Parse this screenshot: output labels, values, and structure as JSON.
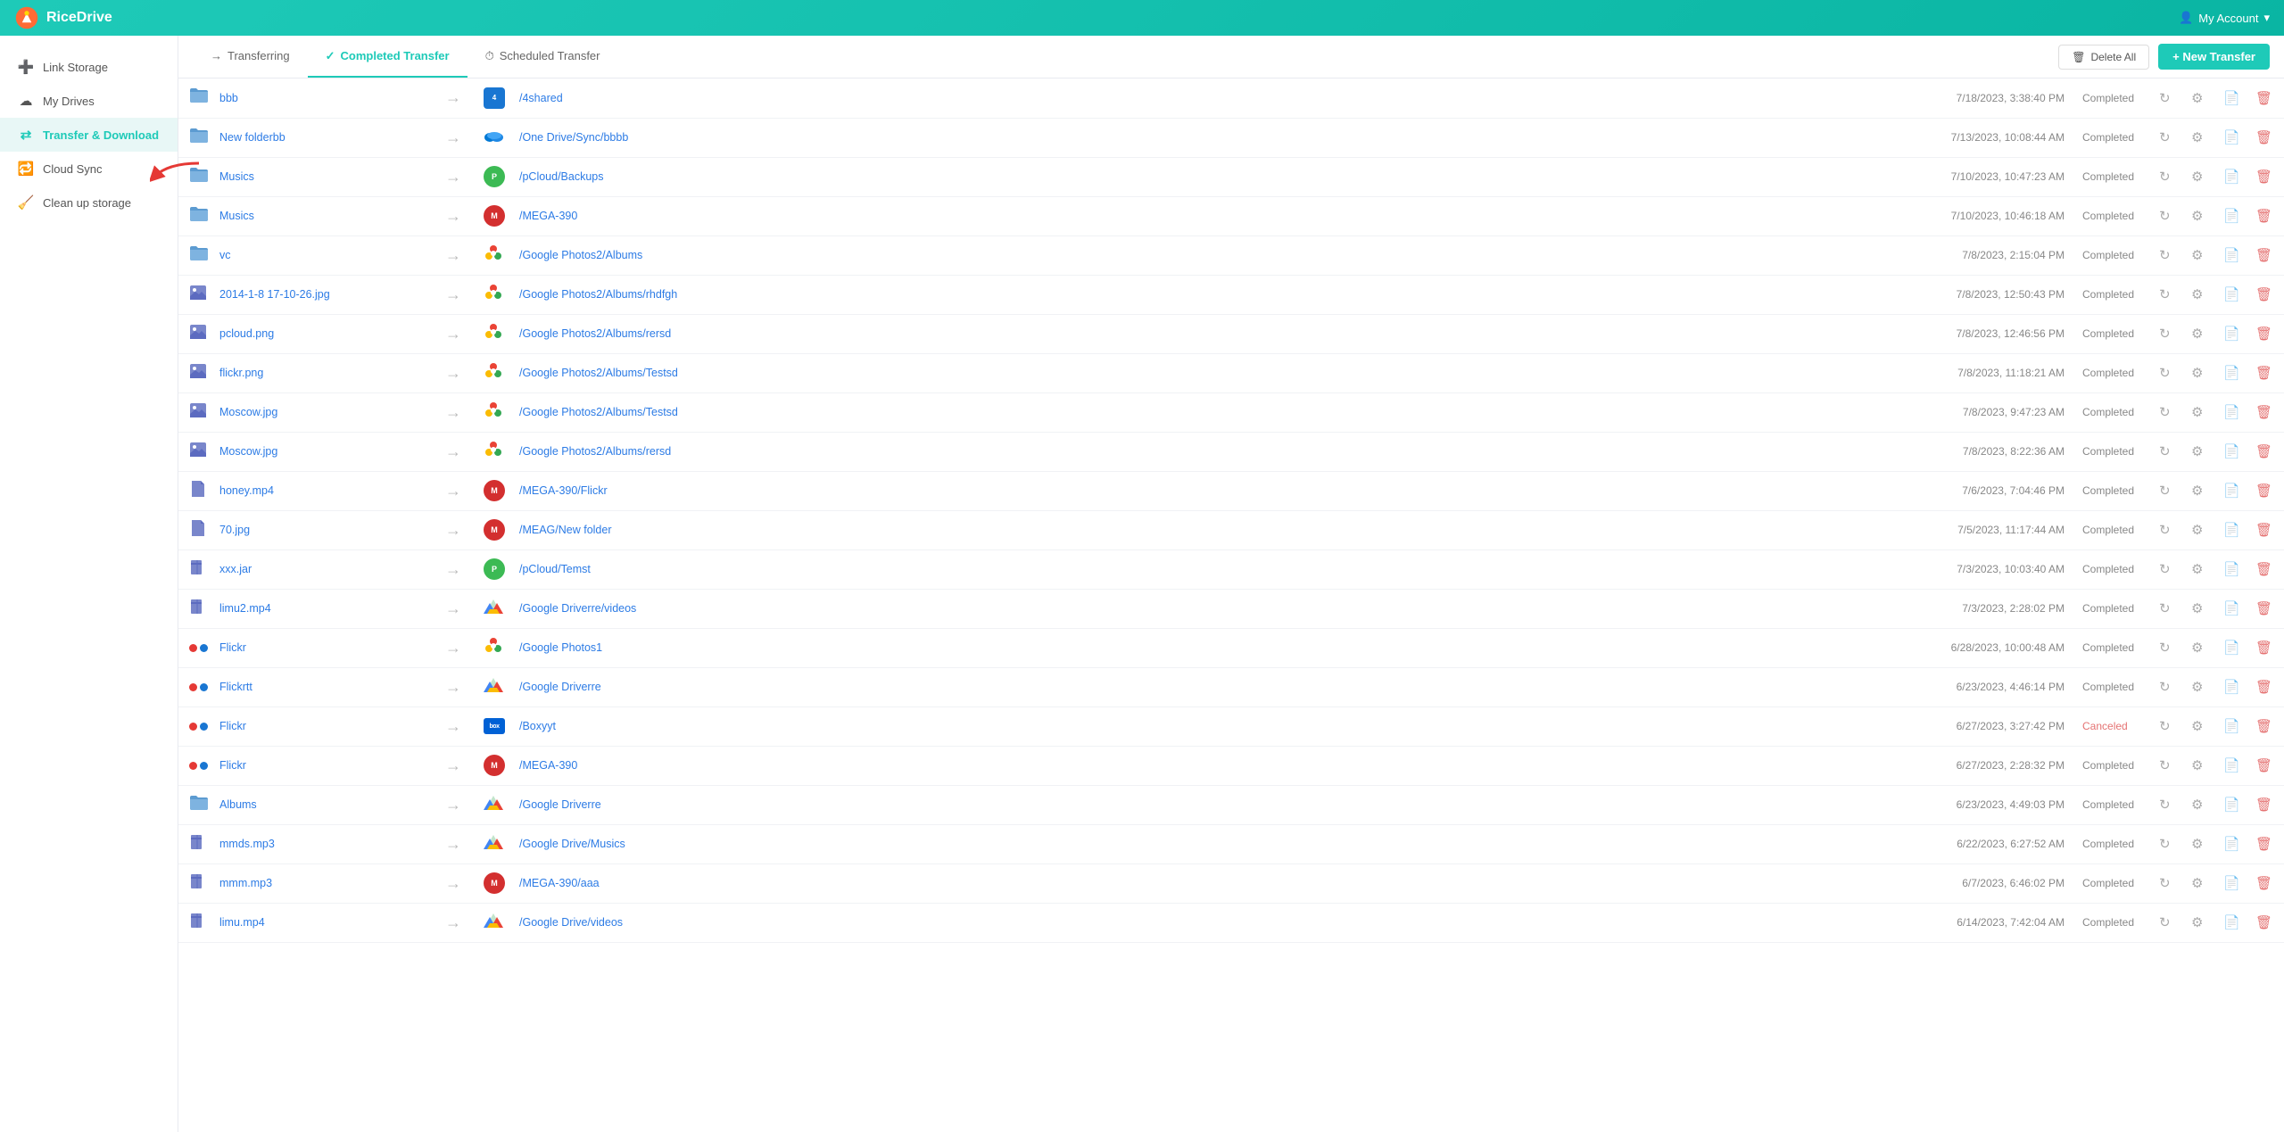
{
  "header": {
    "logo_text": "RiceDrive",
    "account_label": "My Account"
  },
  "sidebar": {
    "items": [
      {
        "id": "link-storage",
        "label": "Link Storage",
        "icon": "➕",
        "active": false
      },
      {
        "id": "my-drives",
        "label": "My Drives",
        "icon": "☁️",
        "active": false
      },
      {
        "id": "transfer-download",
        "label": "Transfer & Download",
        "icon": "🔄",
        "active": true
      },
      {
        "id": "cloud-sync",
        "label": "Cloud Sync",
        "icon": "🔁",
        "active": false
      },
      {
        "id": "clean-storage",
        "label": "Clean up storage",
        "icon": "🧹",
        "active": false
      }
    ]
  },
  "tabs": {
    "items": [
      {
        "id": "transferring",
        "label": "Transferring",
        "icon": "→",
        "active": false
      },
      {
        "id": "completed-transfer",
        "label": "Completed Transfer",
        "icon": "✓",
        "active": true
      },
      {
        "id": "scheduled-transfer",
        "label": "Scheduled Transfer",
        "icon": "⏱",
        "active": false
      }
    ],
    "delete_all_label": "Delete All",
    "new_transfer_label": "+ New Transfer"
  },
  "transfers": [
    {
      "id": 1,
      "src_type": "folder",
      "src_name": "bbb",
      "dest_service": "4shared",
      "dest_path": "/4shared",
      "date": "7/18/2023, 3:38:40 PM",
      "status": "Completed"
    },
    {
      "id": 2,
      "src_type": "folder",
      "src_name": "New folderbb",
      "dest_service": "onedrive",
      "dest_path": "/One Drive/Sync/bbbb",
      "date": "7/13/2023, 10:08:44 AM",
      "status": "Completed"
    },
    {
      "id": 3,
      "src_type": "folder",
      "src_name": "Musics",
      "dest_service": "pcloud",
      "dest_path": "/pCloud/Backups",
      "date": "7/10/2023, 10:47:23 AM",
      "status": "Completed"
    },
    {
      "id": 4,
      "src_type": "folder",
      "src_name": "Musics",
      "dest_service": "mega",
      "dest_path": "/MEGA-390",
      "date": "7/10/2023, 10:46:18 AM",
      "status": "Completed"
    },
    {
      "id": 5,
      "src_type": "folder",
      "src_name": "vc",
      "dest_service": "gphotos",
      "dest_path": "/Google Photos2/Albums",
      "date": "7/8/2023, 2:15:04 PM",
      "status": "Completed"
    },
    {
      "id": 6,
      "src_type": "image",
      "src_name": "2014-1-8 17-10-26.jpg",
      "dest_service": "gphotos",
      "dest_path": "/Google Photos2/Albums/rhdfgh",
      "date": "7/8/2023, 12:50:43 PM",
      "status": "Completed"
    },
    {
      "id": 7,
      "src_type": "image",
      "src_name": "pcloud.png",
      "dest_service": "gphotos",
      "dest_path": "/Google Photos2/Albums/rersd",
      "date": "7/8/2023, 12:46:56 PM",
      "status": "Completed"
    },
    {
      "id": 8,
      "src_type": "image",
      "src_name": "flickr.png",
      "dest_service": "gphotos",
      "dest_path": "/Google Photos2/Albums/Testsd",
      "date": "7/8/2023, 11:18:21 AM",
      "status": "Completed"
    },
    {
      "id": 9,
      "src_type": "image",
      "src_name": "Moscow.jpg",
      "dest_service": "gphotos",
      "dest_path": "/Google Photos2/Albums/Testsd",
      "date": "7/8/2023, 9:47:23 AM",
      "status": "Completed"
    },
    {
      "id": 10,
      "src_type": "image",
      "src_name": "Moscow.jpg",
      "dest_service": "gphotos",
      "dest_path": "/Google Photos2/Albums/rersd",
      "date": "7/8/2023, 8:22:36 AM",
      "status": "Completed"
    },
    {
      "id": 11,
      "src_type": "file",
      "src_name": "honey.mp4",
      "dest_service": "mega",
      "dest_path": "/MEGA-390/Flickr",
      "date": "7/6/2023, 7:04:46 PM",
      "status": "Completed"
    },
    {
      "id": 12,
      "src_type": "file",
      "src_name": "70.jpg",
      "dest_service": "mega",
      "dest_path": "/MEAG/New folder",
      "date": "7/5/2023, 11:17:44 AM",
      "status": "Completed"
    },
    {
      "id": 13,
      "src_type": "archive",
      "src_name": "xxx.jar",
      "dest_service": "pcloud",
      "dest_path": "/pCloud/Temst",
      "date": "7/3/2023, 10:03:40 AM",
      "status": "Completed"
    },
    {
      "id": 14,
      "src_type": "archive",
      "src_name": "limu2.mp4",
      "dest_service": "gdrive",
      "dest_path": "/Google Driverre/videos",
      "date": "7/3/2023, 2:28:02 PM",
      "status": "Completed"
    },
    {
      "id": 15,
      "src_type": "multi",
      "src_name": "Flickr",
      "dest_service": "gphotos",
      "dest_path": "/Google Photos1",
      "date": "6/28/2023, 10:00:48 AM",
      "status": "Completed"
    },
    {
      "id": 16,
      "src_type": "multi",
      "src_name": "Flickrtt",
      "dest_service": "gdrive",
      "dest_path": "/Google Driverre",
      "date": "6/23/2023, 4:46:14 PM",
      "status": "Completed"
    },
    {
      "id": 17,
      "src_type": "multi",
      "src_name": "Flickr",
      "dest_service": "box",
      "dest_path": "/Boxyyt",
      "date": "6/27/2023, 3:27:42 PM",
      "status": "Canceled"
    },
    {
      "id": 18,
      "src_type": "multi",
      "src_name": "Flickr",
      "dest_service": "mega",
      "dest_path": "/MEGA-390",
      "date": "6/27/2023, 2:28:32 PM",
      "status": "Completed"
    },
    {
      "id": 19,
      "src_type": "folder",
      "src_name": "Albums",
      "dest_service": "gdrive",
      "dest_path": "/Google Driverre",
      "date": "6/23/2023, 4:49:03 PM",
      "status": "Completed"
    },
    {
      "id": 20,
      "src_type": "archive",
      "src_name": "mmds.mp3",
      "dest_service": "gdrive",
      "dest_path": "/Google Drive/Musics",
      "date": "6/22/2023, 6:27:52 AM",
      "status": "Completed"
    },
    {
      "id": 21,
      "src_type": "archive",
      "src_name": "mmm.mp3",
      "dest_service": "mega",
      "dest_path": "/MEGA-390/aaa",
      "date": "6/7/2023, 6:46:02 PM",
      "status": "Completed"
    },
    {
      "id": 22,
      "src_type": "archive",
      "src_name": "limu.mp4",
      "dest_service": "gdrive",
      "dest_path": "/Google Drive/videos",
      "date": "6/14/2023, 7:42:04 AM",
      "status": "Completed"
    }
  ]
}
